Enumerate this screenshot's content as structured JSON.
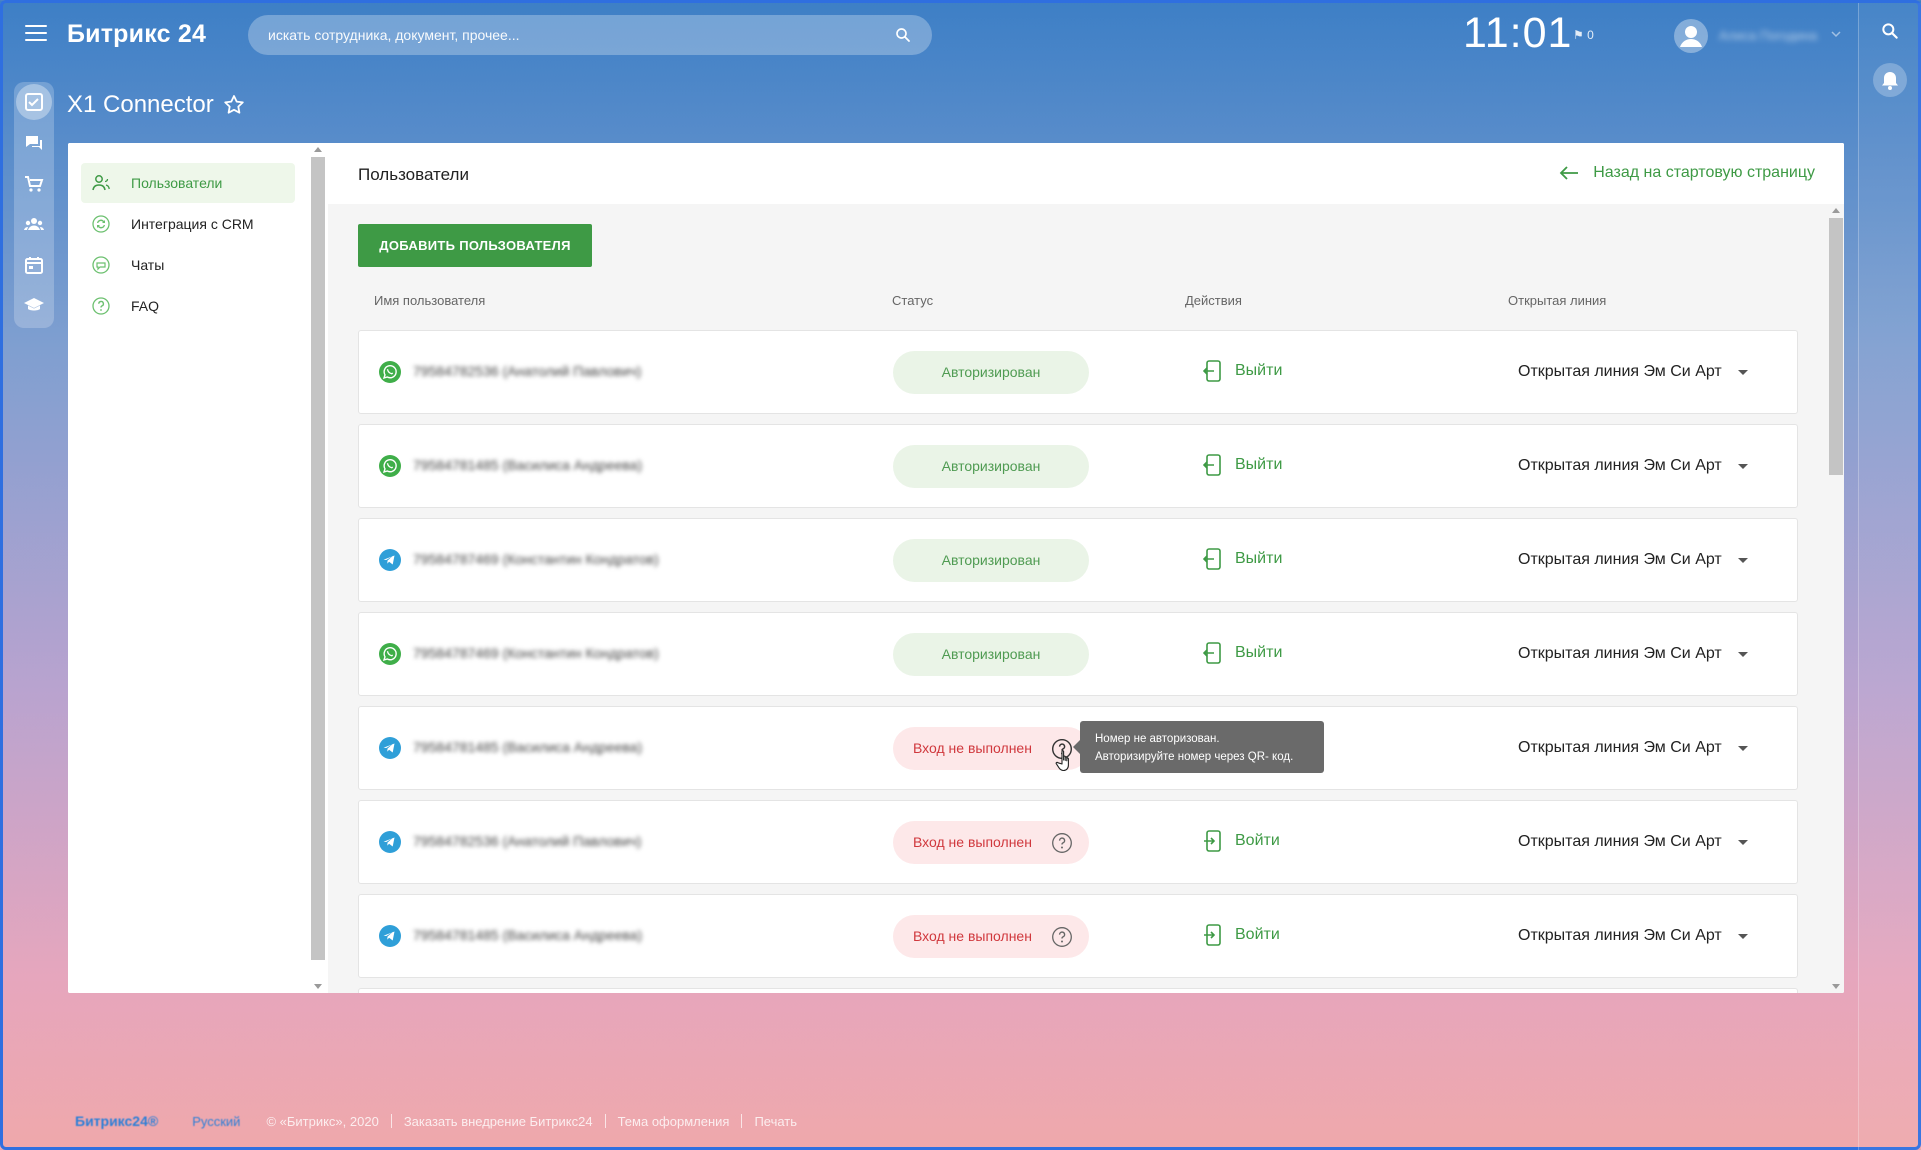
{
  "topbar": {
    "logo": "Битрикс 24",
    "search_placeholder": "искать сотрудника, документ, прочее...",
    "clock": "11:01",
    "flag_count": "0",
    "user_name": "Алиса Погодина"
  },
  "app": {
    "title": "X1 Connector"
  },
  "sidebar": {
    "items": [
      {
        "label": "Пользователи",
        "icon": "users-icon",
        "active": true
      },
      {
        "label": "Интеграция с CRM",
        "icon": "sync-icon",
        "active": false
      },
      {
        "label": "Чаты",
        "icon": "chat-icon",
        "active": false
      },
      {
        "label": "FAQ",
        "icon": "help-icon",
        "active": false
      }
    ]
  },
  "content": {
    "title": "Пользователи",
    "back_link": "Назад на стартовую страницу",
    "add_button": "ДОБАВИТЬ ПОЛЬЗОВАТЕЛЯ",
    "columns": [
      "Имя пользователя",
      "Статус",
      "Действия",
      "Открытая линия"
    ],
    "rows": [
      {
        "messenger": "whatsapp-icon",
        "name": "79584782536 (Анатолий Павлович)",
        "status": "Авторизирован",
        "status_type": "ok",
        "action": "Выйти",
        "line": "Открытая линия Эм Си Арт"
      },
      {
        "messenger": "whatsapp-icon",
        "name": "79584781485 (Василиса Андреева)",
        "status": "Авторизирован",
        "status_type": "ok",
        "action": "Выйти",
        "line": "Открытая линия Эм Си Арт"
      },
      {
        "messenger": "telegram-icon",
        "name": "79584787469 (Константин Кондратов)",
        "status": "Авторизирован",
        "status_type": "ok",
        "action": "Выйти",
        "line": "Открытая линия Эм Си Арт"
      },
      {
        "messenger": "whatsapp-icon",
        "name": "79584787469 (Константин Кондратов)",
        "status": "Авторизирован",
        "status_type": "ok",
        "action": "Выйти",
        "line": "Открытая линия Эм Си Арт"
      },
      {
        "messenger": "telegram-icon",
        "name": "79584781485 (Василиса Андреева)",
        "status": "Вход не выполнен",
        "status_type": "fail",
        "action": "",
        "line": "Открытая линия Эм Си Арт"
      },
      {
        "messenger": "telegram-icon",
        "name": "79584782536 (Анатолий Павлович)",
        "status": "Вход не выполнен",
        "status_type": "fail",
        "action": "Войти",
        "line": "Открытая линия Эм Си Арт"
      },
      {
        "messenger": "telegram-icon",
        "name": "79584781485 (Василиса Андреева)",
        "status": "Вход не выполнен",
        "status_type": "fail",
        "action": "Войти",
        "line": "Открытая линия Эм Си Арт"
      }
    ],
    "tooltip": {
      "line1": "Номер не авторизован.",
      "line2": "Авторизируйте номер через QR- код."
    }
  },
  "footer": {
    "logo": "Битрикс24®",
    "language": "Русский",
    "copyright": "© «Битрикс», 2020",
    "links": [
      "Заказать внедрение Битрикс24",
      "Тема оформления",
      "Печать"
    ]
  },
  "colors": {
    "accent": "#3e9a45",
    "ok_bg": "#eaf4e7",
    "fail_bg": "#fde8e9",
    "fail_text": "#d0383d",
    "whatsapp": "#3fae49",
    "telegram": "#2f9fd8"
  }
}
